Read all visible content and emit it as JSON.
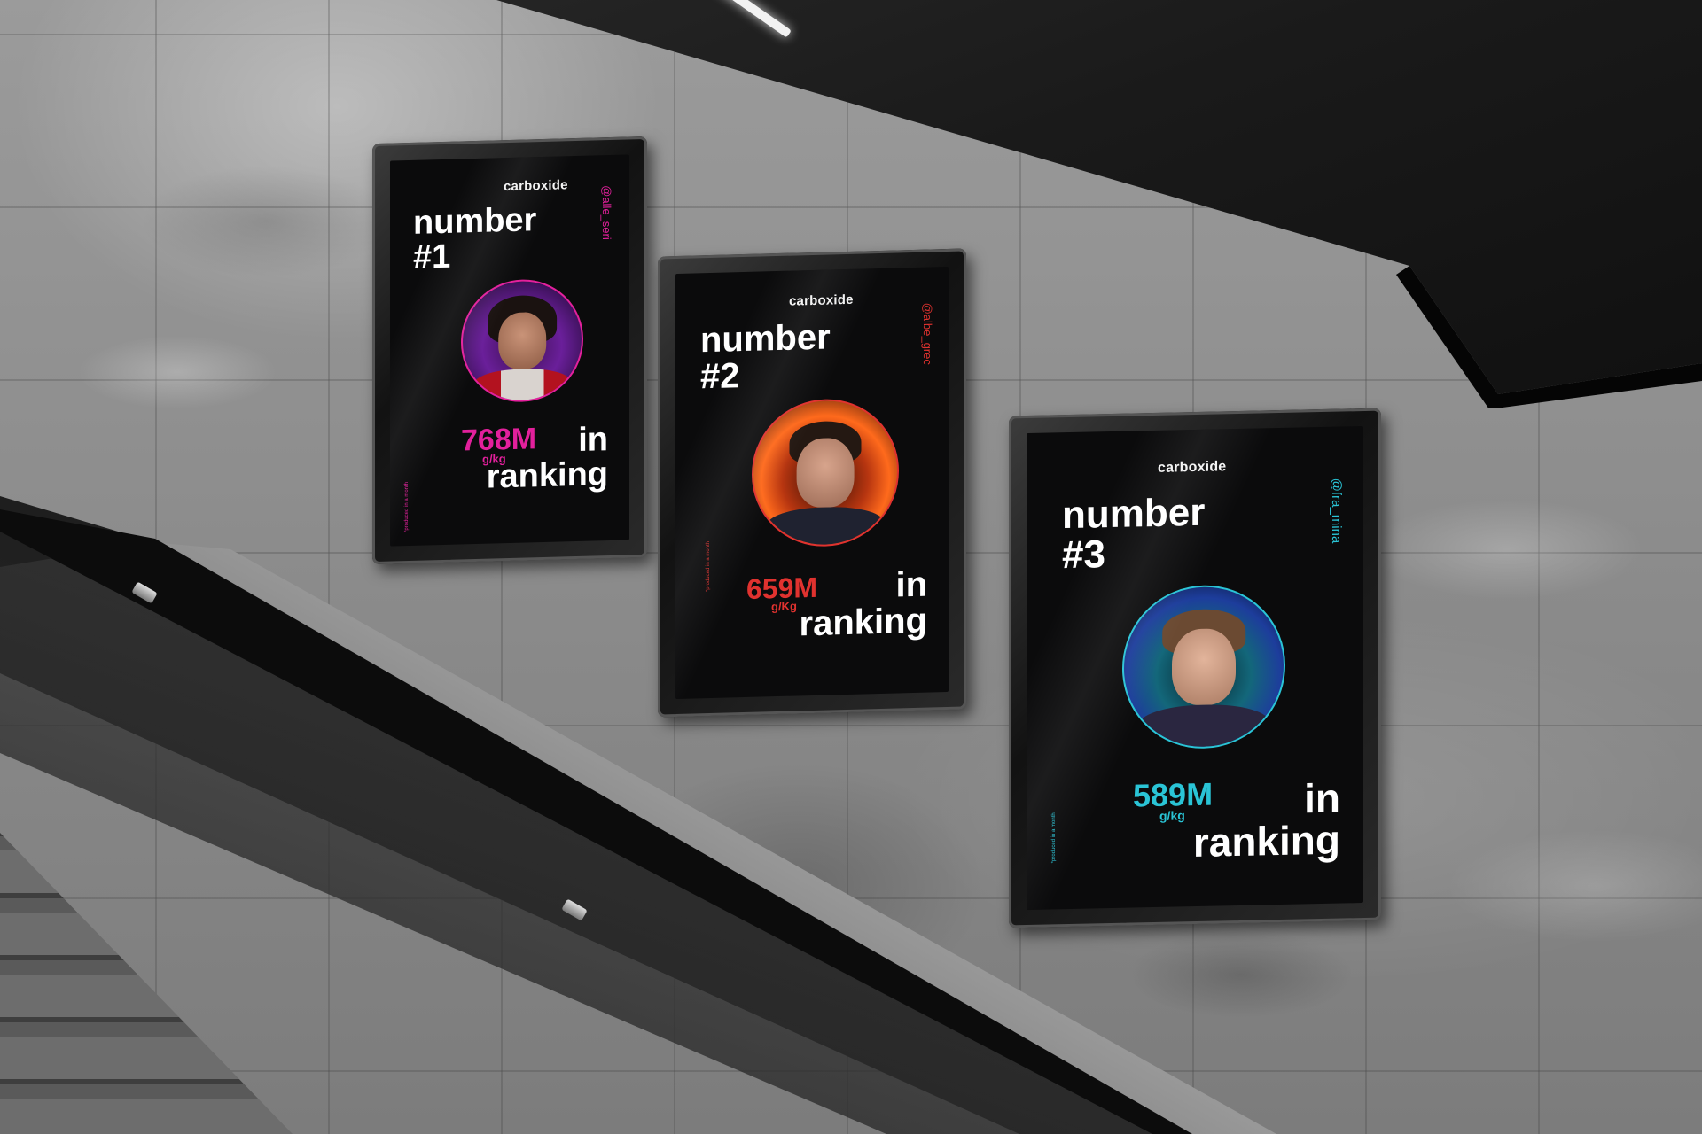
{
  "scene": {
    "posters": [
      {
        "brand": "carboxide",
        "headline_line1": "number",
        "headline_line2": "#1",
        "handle": "@alle_seri",
        "value": "768M",
        "unit": "g/kg",
        "ranking_line1": "in",
        "ranking_line2": "ranking",
        "footnote": "*produced in a month",
        "accent_color": "#e3209c",
        "portrait_theme": "purple"
      },
      {
        "brand": "carboxide",
        "headline_line1": "number",
        "headline_line2": "#2",
        "handle": "@albe_grec",
        "value": "659M",
        "unit": "g/Kg",
        "ranking_line1": "in",
        "ranking_line2": "ranking",
        "footnote": "*produced in a month",
        "accent_color": "#e0322f",
        "portrait_theme": "fire"
      },
      {
        "brand": "carboxide",
        "headline_line1": "number",
        "headline_line2": "#3",
        "handle": "@fra_mina",
        "value": "589M",
        "unit": "g/kg",
        "ranking_line1": "in",
        "ranking_line2": "ranking",
        "footnote": "*produced in a month",
        "accent_color": "#2ac4d6",
        "portrait_theme": "teal"
      }
    ]
  }
}
